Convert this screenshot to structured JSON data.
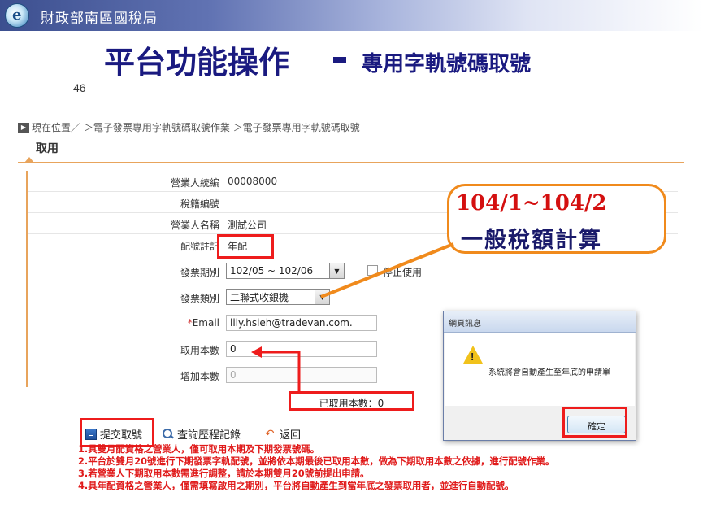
{
  "banner": {
    "org_name": "財政部南區國稅局",
    "logo_letter": "e"
  },
  "slide": {
    "title": "平台功能操作",
    "subtitle": "專用字軌號碼取號",
    "page_number": "46"
  },
  "breadcrumb": {
    "text": "現在位置／ ＞電子發票專用字軌號碼取號作業 ＞電子發票專用字軌號碼取號"
  },
  "section": {
    "title": "取用"
  },
  "form": {
    "fields": [
      {
        "label": "營業人統編",
        "value": "00008000"
      },
      {
        "label": "稅籍編號",
        "value": ""
      },
      {
        "label": "營業人名稱",
        "value": "測試公司"
      },
      {
        "label": "配號註記",
        "value": "年配"
      },
      {
        "label": "發票期別",
        "value": "102/05 ~ 102/06"
      },
      {
        "label": "發票類別",
        "value": "二聯式收銀機"
      },
      {
        "label": "Email",
        "required_mark": "*",
        "value": "lily.hsieh@tradevan.com."
      },
      {
        "label": "取用本數",
        "value": "0"
      },
      {
        "label": "增加本數",
        "value": "0"
      }
    ],
    "stop_use_label": "停止使用",
    "taken_count_label": "已取用本數：0"
  },
  "callout": {
    "line1": "104/1~104/2",
    "line2": "一般稅額計算"
  },
  "actions": {
    "submit_label": "提交取號",
    "history_label": "查詢歷程記錄",
    "back_label": "返回"
  },
  "notes": [
    "1.具雙月配資格之營業人，僅可取用本期及下期發票號碼。",
    "2.平台於雙月20號進行下期發票字軌配號，並將依本期最後已取用本數，做為下期取用本數之依據，進行配號作業。",
    "3.若營業人下期取用本數需進行調整，請於本期雙月20號前提出申請。",
    "4.具年配資格之營業人，僅需填寫啟用之期別，平台將自動產生到當年底之發票取用者，並進行自動配號。"
  ],
  "dialog": {
    "title": "網頁訊息",
    "message": "系統將會自動產生至年底的申請單",
    "ok_label": "確定"
  },
  "colors": {
    "accent_orange": "#e8a45c",
    "highlight_red": "#ee1c1c",
    "title_navy": "#1a1a80"
  }
}
